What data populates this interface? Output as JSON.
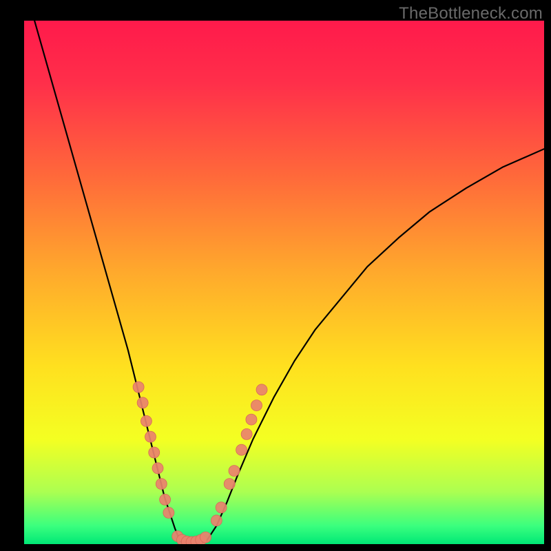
{
  "watermark": "TheBottleneck.com",
  "palette": {
    "gradient_stops": [
      {
        "offset": 0.0,
        "color": "#ff1a4b"
      },
      {
        "offset": 0.12,
        "color": "#ff2f4a"
      },
      {
        "offset": 0.3,
        "color": "#ff6a3a"
      },
      {
        "offset": 0.48,
        "color": "#ffa92c"
      },
      {
        "offset": 0.66,
        "color": "#ffe01f"
      },
      {
        "offset": 0.8,
        "color": "#f4ff22"
      },
      {
        "offset": 0.9,
        "color": "#acff51"
      },
      {
        "offset": 0.965,
        "color": "#3bff7e"
      },
      {
        "offset": 1.0,
        "color": "#00e876"
      }
    ],
    "curve_color": "#000000",
    "marker_fill": "#e9826e",
    "marker_stroke": "#d66a58",
    "frame_color": "#000000"
  },
  "chart_data": {
    "type": "line",
    "title": "",
    "xlabel": "",
    "ylabel": "",
    "xlim": [
      0,
      100
    ],
    "ylim": [
      0,
      100
    ],
    "grid": false,
    "legend": false,
    "series": [
      {
        "name": "left-curve",
        "x": [
          2,
          4,
          6,
          8,
          10,
          12,
          14,
          16,
          18,
          20,
          21,
          22,
          23,
          24,
          25,
          26,
          27,
          28,
          29,
          30
        ],
        "y": [
          100,
          93,
          86,
          79,
          72,
          65,
          58,
          51,
          44,
          37,
          33,
          29,
          25,
          21,
          17,
          13,
          9,
          6,
          3,
          0.5
        ]
      },
      {
        "name": "valley-floor",
        "x": [
          30,
          31,
          32,
          33,
          34,
          35
        ],
        "y": [
          0.5,
          0.3,
          0.2,
          0.2,
          0.3,
          0.5
        ]
      },
      {
        "name": "right-curve",
        "x": [
          35,
          37,
          39,
          41,
          44,
          48,
          52,
          56,
          61,
          66,
          72,
          78,
          85,
          92,
          100
        ],
        "y": [
          0.5,
          3.5,
          8,
          13,
          20,
          28,
          35,
          41,
          47,
          53,
          58.5,
          63.5,
          68,
          72,
          75.5
        ]
      }
    ],
    "markers": {
      "name": "dots",
      "points": [
        {
          "x": 22.0,
          "y": 30.0
        },
        {
          "x": 22.8,
          "y": 27.0
        },
        {
          "x": 23.5,
          "y": 23.5
        },
        {
          "x": 24.3,
          "y": 20.5
        },
        {
          "x": 25.0,
          "y": 17.5
        },
        {
          "x": 25.7,
          "y": 14.5
        },
        {
          "x": 26.4,
          "y": 11.5
        },
        {
          "x": 27.1,
          "y": 8.5
        },
        {
          "x": 27.8,
          "y": 6.0
        },
        {
          "x": 29.5,
          "y": 1.5
        },
        {
          "x": 30.4,
          "y": 0.8
        },
        {
          "x": 31.3,
          "y": 0.5
        },
        {
          "x": 32.2,
          "y": 0.4
        },
        {
          "x": 33.1,
          "y": 0.5
        },
        {
          "x": 34.0,
          "y": 0.8
        },
        {
          "x": 34.9,
          "y": 1.3
        },
        {
          "x": 37.0,
          "y": 4.5
        },
        {
          "x": 37.9,
          "y": 7.0
        },
        {
          "x": 39.5,
          "y": 11.5
        },
        {
          "x": 40.4,
          "y": 14.0
        },
        {
          "x": 41.8,
          "y": 18.0
        },
        {
          "x": 42.8,
          "y": 21.0
        },
        {
          "x": 43.7,
          "y": 23.8
        },
        {
          "x": 44.7,
          "y": 26.5
        },
        {
          "x": 45.7,
          "y": 29.5
        }
      ],
      "radius_px": 8
    }
  }
}
